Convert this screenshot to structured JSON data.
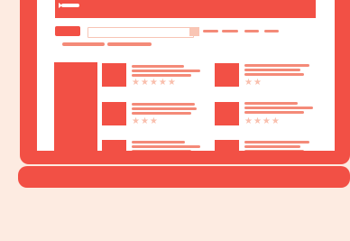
{
  "colors": {
    "background": "#fdebe1",
    "brand_red": "#f25045",
    "muted_red": "#f48a78",
    "light_peach": "#f9c5b4",
    "screen": "#ffffff"
  },
  "header": {
    "logo_icon": "arrow-logo-icon"
  },
  "search": {
    "placeholder": ""
  },
  "nav": {
    "links": [
      "",
      "",
      "",
      ""
    ]
  },
  "breadcrumb": {
    "items": [
      "",
      ""
    ]
  },
  "products": [
    {
      "stars": "★★★★★",
      "rating": 5
    },
    {
      "stars": "★★",
      "rating": 2
    },
    {
      "stars": "★★★",
      "rating": 3
    },
    {
      "stars": "★★★★",
      "rating": 4
    },
    {
      "stars": "",
      "rating": null
    },
    {
      "stars": "",
      "rating": null
    }
  ]
}
